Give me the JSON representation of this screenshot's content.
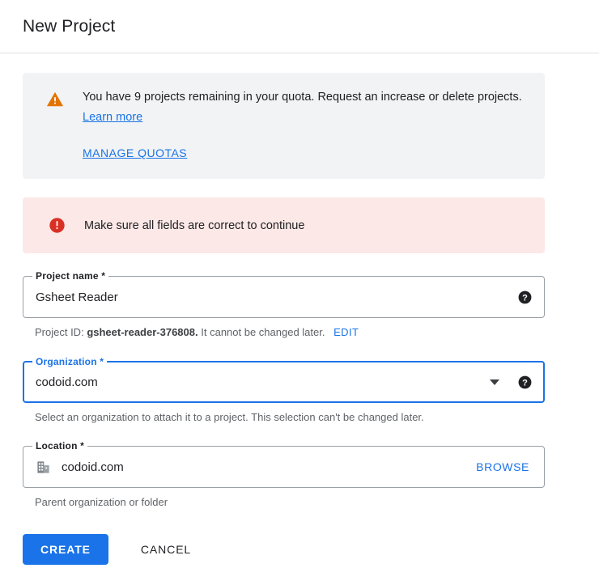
{
  "header": {
    "title": "New Project"
  },
  "warning_banner": {
    "icon": "warning-triangle-icon",
    "icon_color": "#e37400",
    "background": "#f1f3f4",
    "text_before_link": "You have 9 projects remaining in your quota. Request an increase or delete projects.",
    "inline_link": "Learn more",
    "action_link": "MANAGE QUOTAS"
  },
  "error_banner": {
    "icon": "error-circle-icon",
    "icon_color": "#d93025",
    "background": "#fce8e6",
    "text": "Make sure all fields are correct to continue"
  },
  "fields": {
    "project_name": {
      "label": "Project name *",
      "value": "Gsheet Reader",
      "help_icon": "help-icon",
      "helper_prefix": "Project ID:",
      "helper_id": "gsheet-reader-376808.",
      "helper_suffix": "It cannot be changed later.",
      "helper_link": "EDIT"
    },
    "organization": {
      "label": "Organization *",
      "value": "codoid.com",
      "focused": true,
      "dropdown_icon": "chevron-down-icon",
      "help_icon": "help-icon",
      "helper": "Select an organization to attach it to a project. This selection can't be changed later."
    },
    "location": {
      "label": "Location *",
      "value": "codoid.com",
      "leading_icon": "organization-building-icon",
      "browse_label": "BROWSE",
      "helper": "Parent organization or folder"
    }
  },
  "actions": {
    "create_label": "CREATE",
    "cancel_label": "CANCEL"
  },
  "colors": {
    "accent": "#1a73e8",
    "warning": "#e37400",
    "error": "#d93025",
    "text_primary": "#202124",
    "text_secondary": "#5f6368",
    "border": "#9aa0a6"
  }
}
